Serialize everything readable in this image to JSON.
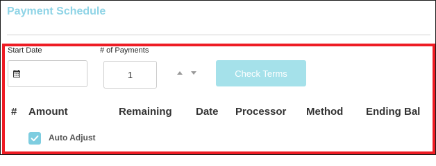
{
  "section": {
    "title": "Payment Schedule"
  },
  "form": {
    "start_date_label": "Start Date",
    "start_date_value": "",
    "payments_label": "# of Payments",
    "payments_value": "1",
    "check_terms_label": "Check Terms"
  },
  "table": {
    "headers": [
      "#",
      "Amount",
      "Remaining",
      "Date",
      "Processor",
      "Method",
      "Ending Bal"
    ]
  },
  "auto_adjust": {
    "label": "Auto Adjust",
    "checked": true
  },
  "colors": {
    "title": "#8fd4e6",
    "highlight_border": "#ee1c24",
    "button_bg": "#a5e1ea",
    "checkbox_bg": "#7ecde0"
  },
  "icons": [
    "calendar-icon",
    "arrow-up-icon",
    "arrow-down-icon",
    "checkmark-icon"
  ]
}
